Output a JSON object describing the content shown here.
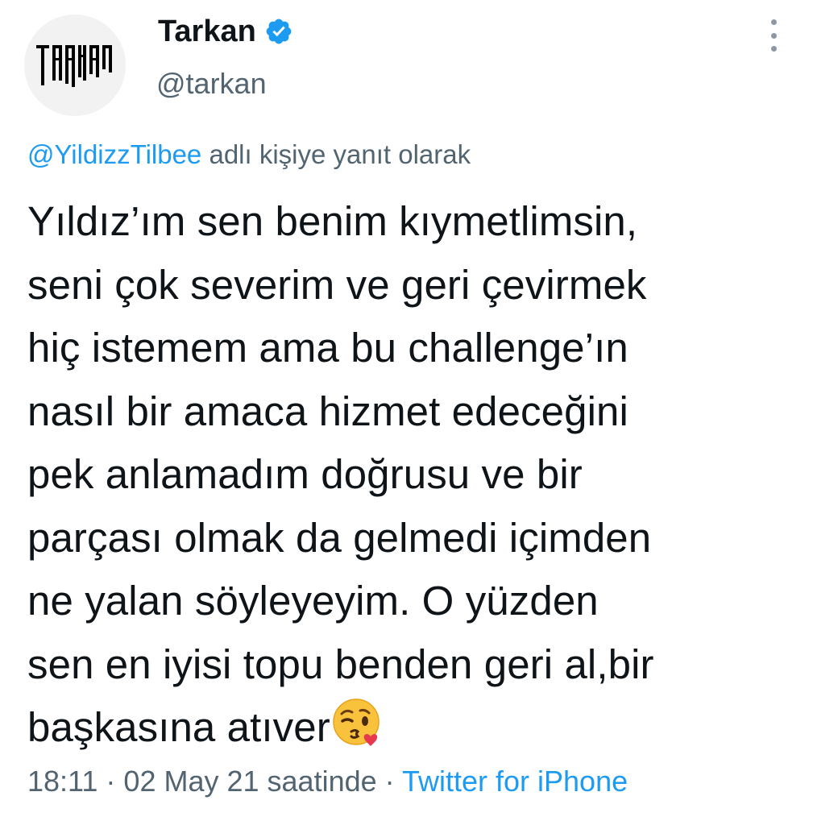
{
  "author": {
    "display_name": "Tarkan",
    "handle": "@tarkan",
    "avatar_logo_text": "TARKAN",
    "verified_icon": "verified-badge-icon"
  },
  "menu": {
    "icon": "more-options-icon"
  },
  "reply_context": {
    "mention": "@YildizzTilbee",
    "suffix": " adlı kişiye yanıt olarak"
  },
  "tweet": {
    "lines": [
      "Yıldız’ım sen benim kıymetlimsin,",
      "seni çok severim ve geri çevirmek",
      "hiç istemem ama bu challenge’ın",
      "nasıl bir amaca hizmet edeceğini",
      "pek anlamadım doğrusu ve bir",
      "parçası olmak da gelmedi içimden",
      "ne yalan söyleyeyim. O yüzden",
      "sen en iyisi topu benden geri al,bir",
      "başkasına atıver"
    ],
    "emoji": "face-blowing-a-kiss-emoji"
  },
  "meta": {
    "time": "18:11",
    "sep1": " · ",
    "date": "02 May 21 saatinde",
    "sep2": " · ",
    "source": "Twitter for iPhone"
  },
  "colors": {
    "link": "#1d9bf0",
    "secondary_text": "#536471",
    "primary_text": "#0f1419",
    "verified": "#1d9bf0"
  }
}
